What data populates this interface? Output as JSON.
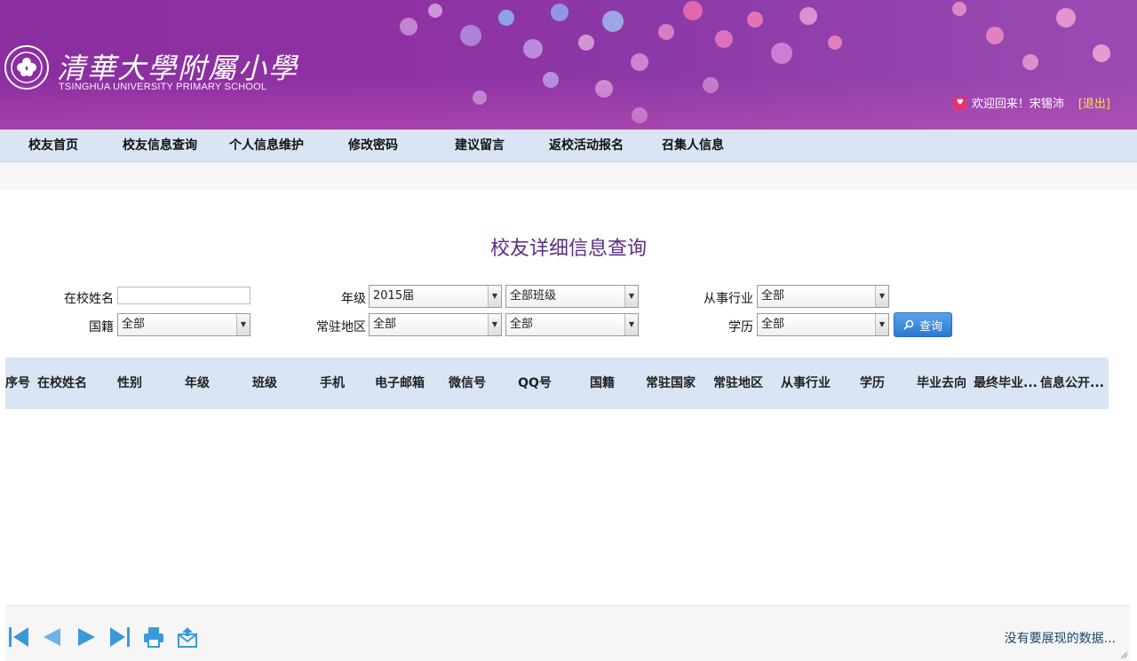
{
  "header": {
    "school_name_cn": "清華大學附屬小學",
    "school_name_en": "TSINGHUA UNIVERSITY PRIMARY SCHOOL",
    "welcome_text": "欢迎回来！宋锡沛",
    "logout_label": "[退出]"
  },
  "nav": {
    "items": [
      {
        "label": "校友首页"
      },
      {
        "label": "校友信息查询"
      },
      {
        "label": "个人信息维护"
      },
      {
        "label": "修改密码"
      },
      {
        "label": "建议留言"
      },
      {
        "label": "返校活动报名"
      },
      {
        "label": "召集人信息"
      }
    ]
  },
  "page": {
    "title": "校友详细信息查询"
  },
  "form": {
    "name_label": "在校姓名",
    "name_value": "",
    "grade_label": "年级",
    "grade_value": "2015届",
    "class_value": "全部班级",
    "industry_label": "从事行业",
    "industry_value": "全部",
    "nationality_label": "国籍",
    "nationality_value": "全部",
    "region_label": "常驻地区",
    "region_value": "全部",
    "subregion_value": "全部",
    "education_label": "学历",
    "education_value": "全部",
    "query_label": "查询"
  },
  "table": {
    "columns": [
      "序号",
      "在校姓名",
      "性别",
      "年级",
      "班级",
      "手机",
      "电子邮箱",
      "微信号",
      "QQ号",
      "国籍",
      "常驻国家",
      "常驻地区",
      "从事行业",
      "学历",
      "毕业去向",
      "最终毕业...",
      "信息公开..."
    ]
  },
  "pager": {
    "empty_text": "没有要展现的数据..."
  },
  "colors": {
    "banner": "#8a2ea0",
    "nav_bg": "#d9e5f4",
    "title": "#5a2d82",
    "button": "#2b79d1",
    "pager_icon": "#3a9ad9"
  }
}
